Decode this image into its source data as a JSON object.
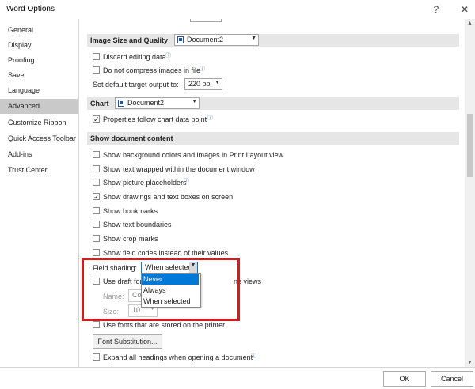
{
  "window": {
    "title": "Word Options",
    "help_label": "?",
    "close_label": "✕"
  },
  "sidebar": {
    "items": [
      {
        "label": "General",
        "active": false
      },
      {
        "label": "Display",
        "active": false
      },
      {
        "label": "Proofing",
        "active": false
      },
      {
        "label": "Save",
        "active": false
      },
      {
        "label": "Language",
        "active": false
      },
      {
        "label": "Advanced",
        "active": true
      },
      {
        "label": "Customize Ribbon",
        "active": false
      },
      {
        "label": "Quick Access Toolbar",
        "active": false
      },
      {
        "label": "Add-ins",
        "active": false
      },
      {
        "label": "Trust Center",
        "active": false
      }
    ]
  },
  "image_size": {
    "title": "Image Size and Quality",
    "document": "Document2",
    "discard_editing": {
      "label": "Discard editing data",
      "checked": false
    },
    "no_compress": {
      "label": "Do not compress images in file",
      "checked": false
    },
    "target_output_label": "Set default target output to:",
    "target_output_value": "220 ppi"
  },
  "chart": {
    "title": "Chart",
    "document": "Document2",
    "follow_data_point": {
      "label": "Properties follow chart data point",
      "checked": true
    }
  },
  "show_doc": {
    "title": "Show document content",
    "items": [
      {
        "label": "Show background colors and images in Print Layout view",
        "checked": false
      },
      {
        "label": "Show text wrapped within the document window",
        "checked": false
      },
      {
        "label": "Show picture placeholders",
        "checked": false
      },
      {
        "label": "Show drawings and text boxes on screen",
        "checked": true
      },
      {
        "label": "Show bookmarks",
        "checked": false
      },
      {
        "label": "Show text boundaries",
        "checked": false
      },
      {
        "label": "Show crop marks",
        "checked": false
      },
      {
        "label": "Show field codes instead of their values",
        "checked": false
      }
    ],
    "field_shading_label": "Field shading:",
    "field_shading_value": "When selected",
    "field_shading_options": [
      "Never",
      "Always",
      "When selected"
    ],
    "draft_font_label_start": "Use draft fon",
    "draft_font_label_end": "ne views",
    "name_label": "Name:",
    "name_value": "Co",
    "size_label": "Size:",
    "size_value": "10",
    "use_printer_fonts": {
      "label": "Use fonts that are stored on the printer",
      "checked": false
    },
    "font_substitution_label": "Font Substitution...",
    "expand_headings": {
      "label": "Expand all headings when opening a document",
      "checked": false
    }
  },
  "footer": {
    "ok_label": "OK",
    "cancel_label": "Cancel"
  },
  "colors": {
    "highlight": "#0078d7",
    "red_box": "#cc1f1f",
    "active_nav": "#c9c9c9"
  }
}
